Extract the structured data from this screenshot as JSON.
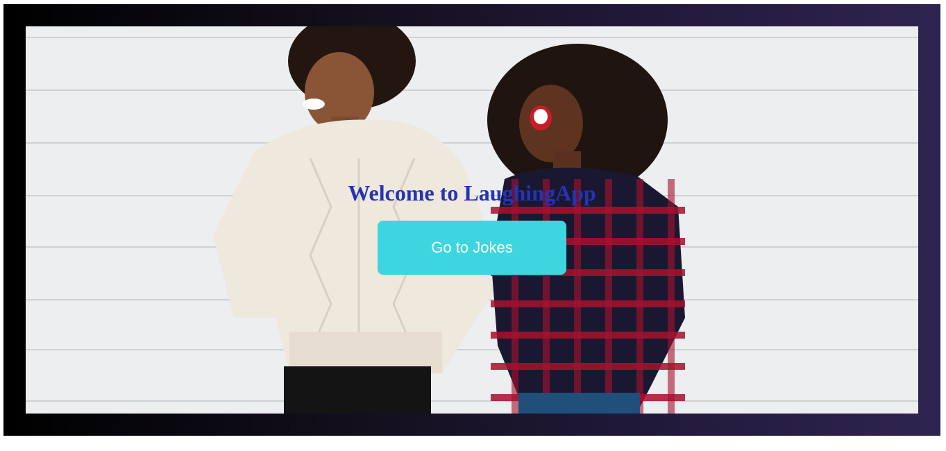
{
  "hero": {
    "title": "Welcome to LaughingApp",
    "button_label": "Go to Jokes",
    "image_description_icon": "two-women-laughing-photo"
  },
  "colors": {
    "frame_gradient_start": "#000000",
    "frame_gradient_end": "#2e2450",
    "title": "#2533b8",
    "button_bg": "#3dd5e0",
    "button_text": "#ffffff"
  }
}
